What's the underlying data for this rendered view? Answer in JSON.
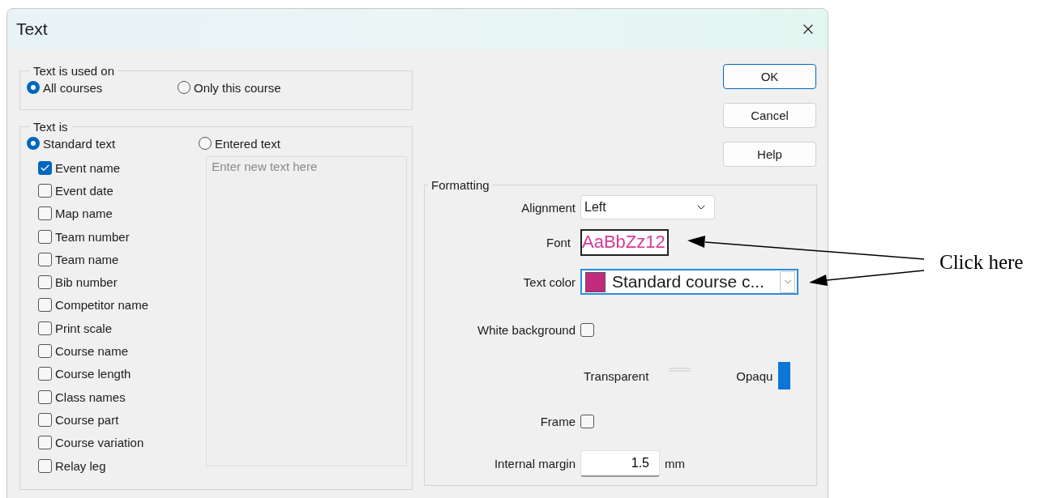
{
  "window": {
    "title": "Text"
  },
  "usage": {
    "label": "Text is used on",
    "options": [
      {
        "label": "All courses",
        "selected": true
      },
      {
        "label": "Only this course",
        "selected": false
      }
    ]
  },
  "source": {
    "label": "Text is",
    "options": [
      {
        "label": "Standard text",
        "selected": true
      },
      {
        "label": "Entered text",
        "selected": false
      }
    ],
    "fields": [
      {
        "label": "Event name",
        "checked": true
      },
      {
        "label": "Event date",
        "checked": false
      },
      {
        "label": "Map name",
        "checked": false
      },
      {
        "label": "Team number",
        "checked": false
      },
      {
        "label": "Team name",
        "checked": false
      },
      {
        "label": "Bib number",
        "checked": false
      },
      {
        "label": "Competitor name",
        "checked": false
      },
      {
        "label": "Print scale",
        "checked": false
      },
      {
        "label": "Course name",
        "checked": false
      },
      {
        "label": "Course length",
        "checked": false
      },
      {
        "label": "Class names",
        "checked": false
      },
      {
        "label": "Course part",
        "checked": false
      },
      {
        "label": "Course variation",
        "checked": false
      },
      {
        "label": "Relay leg",
        "checked": false
      }
    ],
    "entered_text": {
      "placeholder": "Enter new text here"
    }
  },
  "buttons": [
    {
      "label": "OK",
      "default": true
    },
    {
      "label": "Cancel",
      "default": false
    },
    {
      "label": "Help",
      "default": false
    }
  ],
  "formatting": {
    "label": "Formatting",
    "alignment": {
      "label": "Alignment",
      "value": "Left"
    },
    "font": {
      "label": "Font",
      "sample": "AaBbZz12"
    },
    "text_color": {
      "label": "Text color",
      "value": "Standard course c...",
      "focused": true
    },
    "white_background": {
      "label": "White background",
      "checked": false
    },
    "opacity": {
      "start_label": "Transparent",
      "end_label": "Opaqu"
    },
    "frame": {
      "label": "Frame",
      "checked": false
    },
    "internal_margin": {
      "label": "Internal margin",
      "value": "1.5",
      "unit": "mm"
    }
  },
  "annotation": {
    "text": "Click here"
  }
}
